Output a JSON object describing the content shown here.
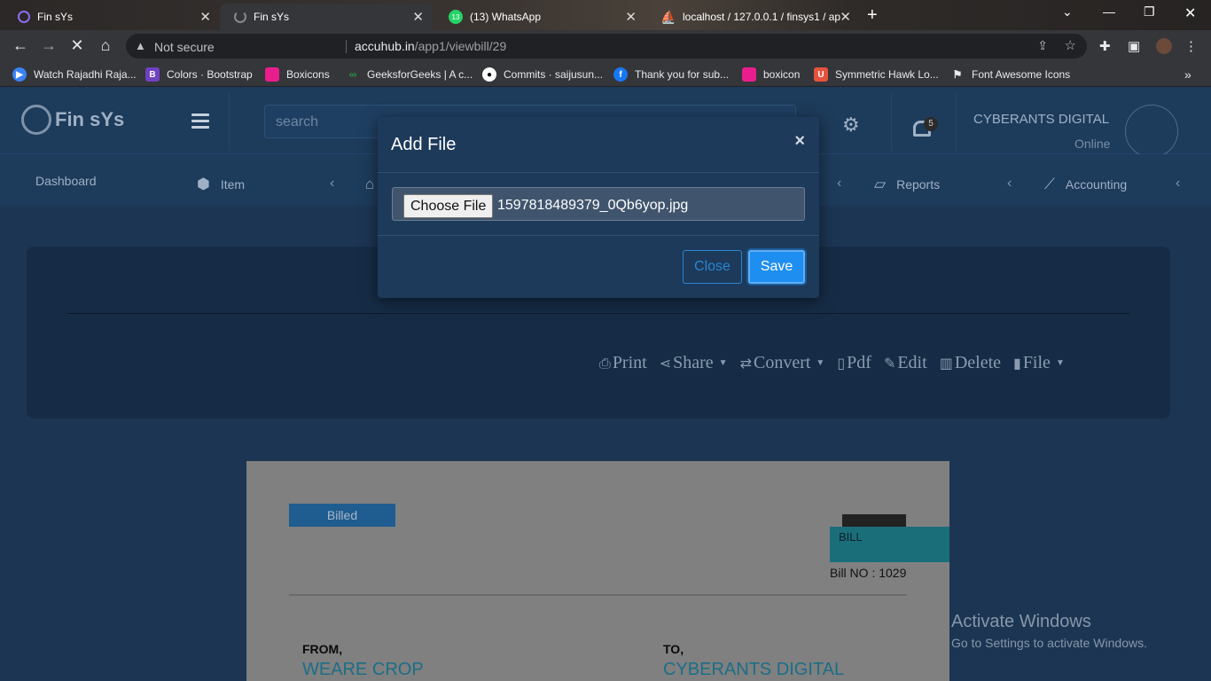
{
  "browser": {
    "tabs": [
      {
        "title": "Fin sYs",
        "active": false
      },
      {
        "title": "Fin sYs",
        "active": true
      },
      {
        "title": "(13) WhatsApp",
        "active": false
      },
      {
        "title": "localhost / 127.0.0.1 / finsys1 / ap",
        "active": false
      }
    ],
    "whatsapp_count": "13",
    "security_label": "Not secure",
    "url_host": "accuhub.in",
    "url_path": "/app1/viewbill/29",
    "bookmarks": [
      {
        "label": "Watch Rajadhi Raja...",
        "color": "#3b82f6",
        "glyph": "▶"
      },
      {
        "label": "Colors · Bootstrap",
        "color": "#6f42c1",
        "glyph": "B"
      },
      {
        "label": "Boxicons",
        "color": "#e91e8c",
        "glyph": "◆"
      },
      {
        "label": "GeeksforGeeks | A c...",
        "color": "#2f8d46",
        "glyph": "∞"
      },
      {
        "label": "Commits · saijusun...",
        "color": "#ffffff",
        "glyph": "●"
      },
      {
        "label": "Thank you for sub...",
        "color": "#1877f2",
        "glyph": "f"
      },
      {
        "label": "boxicon",
        "color": "#e91e8c",
        "glyph": "◆"
      },
      {
        "label": "Symmetric Hawk Lo...",
        "color": "#e5533d",
        "glyph": "U"
      },
      {
        "label": "Font Awesome Icons",
        "color": "#e8eaed",
        "glyph": "⚑"
      }
    ]
  },
  "app": {
    "brand": "Fin sYs",
    "search_placeholder": "search",
    "notification_count": "5",
    "company": "CYBERANTS DIGITAL",
    "status": "Online",
    "nav": {
      "dashboard": "Dashboard",
      "item": "Item",
      "reports": "Reports",
      "accounting": "Accounting"
    },
    "actions": {
      "print": "Print",
      "share": "Share",
      "convert": "Convert",
      "pdf": "Pdf",
      "edit": "Edit",
      "delete": "Delete",
      "file": "File"
    },
    "bill": {
      "status": "Billed",
      "type": "BILL",
      "number": "Bill NO : 1029",
      "from_label": "FROM,",
      "from_name": "WEARE CROP",
      "to_label": "TO,",
      "to_name": "CYBERANTS DIGITAL"
    }
  },
  "modal": {
    "title": "Add File",
    "close_symbol": "×",
    "choose_label": "Choose File",
    "file_name": "1597818489379_0Qb6yop.jpg",
    "close_button": "Close",
    "save_button": "Save"
  },
  "watermark": {
    "line1": "Activate Windows",
    "line2": "Go to Settings to activate Windows."
  }
}
